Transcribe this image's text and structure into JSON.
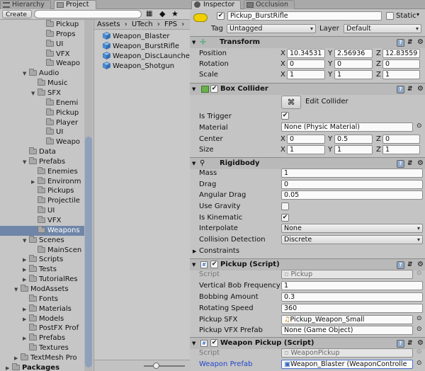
{
  "tabs": {
    "hierarchy": "Hierarchy",
    "project": "Project",
    "inspector": "Inspector",
    "occlusion": "Occlusion"
  },
  "project": {
    "create_label": "Create",
    "tree": [
      {
        "label": "Pickup",
        "indent": 4,
        "arrow": ""
      },
      {
        "label": "Props",
        "indent": 4,
        "arrow": ""
      },
      {
        "label": "UI",
        "indent": 4,
        "arrow": ""
      },
      {
        "label": "VFX",
        "indent": 4,
        "arrow": ""
      },
      {
        "label": "Weapo",
        "indent": 4,
        "arrow": ""
      },
      {
        "label": "Audio",
        "indent": 2,
        "arrow": "▼"
      },
      {
        "label": "Music",
        "indent": 3,
        "arrow": ""
      },
      {
        "label": "SFX",
        "indent": 3,
        "arrow": "▼"
      },
      {
        "label": "Enemi",
        "indent": 4,
        "arrow": ""
      },
      {
        "label": "Pickup",
        "indent": 4,
        "arrow": ""
      },
      {
        "label": "Player",
        "indent": 4,
        "arrow": ""
      },
      {
        "label": "UI",
        "indent": 4,
        "arrow": ""
      },
      {
        "label": "Weapo",
        "indent": 4,
        "arrow": ""
      },
      {
        "label": "Data",
        "indent": 2,
        "arrow": ""
      },
      {
        "label": "Prefabs",
        "indent": 2,
        "arrow": "▼"
      },
      {
        "label": "Enemies",
        "indent": 3,
        "arrow": ""
      },
      {
        "label": "Environm",
        "indent": 3,
        "arrow": "▶"
      },
      {
        "label": "Pickups",
        "indent": 3,
        "arrow": ""
      },
      {
        "label": "Projectile",
        "indent": 3,
        "arrow": ""
      },
      {
        "label": "UI",
        "indent": 3,
        "arrow": ""
      },
      {
        "label": "VFX",
        "indent": 3,
        "arrow": ""
      },
      {
        "label": "Weapons",
        "indent": 3,
        "arrow": "",
        "selected": true
      },
      {
        "label": "Scenes",
        "indent": 2,
        "arrow": "▼"
      },
      {
        "label": "MainScen",
        "indent": 3,
        "arrow": ""
      },
      {
        "label": "Scripts",
        "indent": 2,
        "arrow": "▶"
      },
      {
        "label": "Tests",
        "indent": 2,
        "arrow": "▶"
      },
      {
        "label": "TutorialRes",
        "indent": 2,
        "arrow": "▶"
      },
      {
        "label": "ModAssets",
        "indent": 1,
        "arrow": "▼"
      },
      {
        "label": "Fonts",
        "indent": 2,
        "arrow": ""
      },
      {
        "label": "Materials",
        "indent": 2,
        "arrow": "▶"
      },
      {
        "label": "Models",
        "indent": 2,
        "arrow": "▶"
      },
      {
        "label": "PostFX Prof",
        "indent": 2,
        "arrow": ""
      },
      {
        "label": "Prefabs",
        "indent": 2,
        "arrow": "▶"
      },
      {
        "label": "Textures",
        "indent": 2,
        "arrow": ""
      },
      {
        "label": "TextMesh Pro",
        "indent": 1,
        "arrow": "▶"
      },
      {
        "label": "Packages",
        "indent": 0,
        "arrow": "▶",
        "bold": true
      }
    ],
    "breadcrumb": [
      "Assets",
      "UTech",
      "FPS"
    ],
    "assets": [
      "Weapon_Blaster",
      "Weapon_BurstRifle",
      "Weapon_DiscLaunche",
      "Weapon_Shotgun"
    ],
    "slider_value": 0.3
  },
  "inspector": {
    "object_name": "Pickup_BurstRifle",
    "static_label": "Static",
    "tag_label": "Tag",
    "tag_value": "Untagged",
    "layer_label": "Layer",
    "layer_value": "Default",
    "transform": {
      "title": "Transform",
      "position_label": "Position",
      "position": [
        "10.34531",
        "2.56936",
        "12.83559"
      ],
      "rotation_label": "Rotation",
      "rotation": [
        "0",
        "0",
        "0"
      ],
      "scale_label": "Scale",
      "scale": [
        "1",
        "1",
        "1"
      ]
    },
    "axis": [
      "X",
      "Y",
      "Z"
    ],
    "box_collider": {
      "title": "Box Collider",
      "edit_label": "Edit Collider",
      "is_trigger_label": "Is Trigger",
      "material_label": "Material",
      "material_value": "None (Physic Material)",
      "center_label": "Center",
      "center": [
        "0",
        "0.5",
        "0"
      ],
      "size_label": "Size",
      "size": [
        "1",
        "1",
        "1"
      ]
    },
    "rigidbody": {
      "title": "Rigidbody",
      "mass_label": "Mass",
      "mass": "1",
      "drag_label": "Drag",
      "drag": "0",
      "angular_drag_label": "Angular Drag",
      "angular_drag": "0.05",
      "use_gravity_label": "Use Gravity",
      "is_kinematic_label": "Is Kinematic",
      "interpolate_label": "Interpolate",
      "interpolate": "None",
      "collision_label": "Collision Detection",
      "collision": "Discrete",
      "constraints_label": "Constraints"
    },
    "pickup": {
      "title": "Pickup (Script)",
      "script_label": "Script",
      "script_value": "Pickup",
      "bob_label": "Vertical Bob Frequency",
      "bob": "1",
      "bobbing_label": "Bobbing Amount",
      "bobbing": "0.3",
      "rot_label": "Rotating Speed",
      "rot": "360",
      "sfx_label": "Pickup SFX",
      "sfx": "Pickup_Weapon_Small",
      "vfx_label": "Pickup VFX Prefab",
      "vfx": "None (Game Object)"
    },
    "weapon_pickup": {
      "title": "Weapon Pickup (Script)",
      "script_label": "Script",
      "script_value": "WeaponPickup",
      "prefab_label": "Weapon Prefab",
      "prefab": "Weapon_Blaster (WeaponControlle"
    }
  },
  "colors": {
    "selection": "#6f86a8",
    "prefab_link": "#2244cc"
  }
}
